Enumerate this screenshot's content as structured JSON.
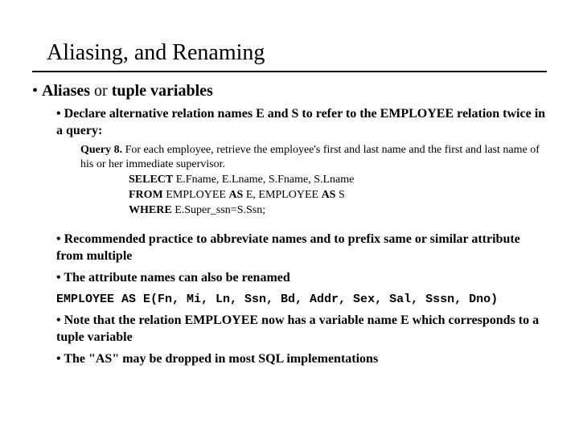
{
  "title": "Aliasing, and Renaming",
  "main_bullet": {
    "strong1": "Aliases",
    "mid": " or ",
    "strong2": "tuple variables"
  },
  "sub1": "Declare alternative relation names E and S to refer to the EMPLOYEE relation twice in a query:",
  "query_label": "Query 8.",
  "query_text": " For each employee, retrieve the employee's first and last name and the first and last name of his or her immediate supervisor.",
  "sql": {
    "select_kw": "SELECT",
    "select_rest": "   E.Fname, E.Lname, S.Fname, S.Lname",
    "from_kw": "FROM",
    "from_mid": "     EMPLOYEE ",
    "as1": "AS",
    "from_mid2": " E, EMPLOYEE ",
    "as2": "AS",
    "from_end": " S",
    "where_kw": "WHERE",
    "where_rest": " E.Super_ssn=S.Ssn;"
  },
  "b2": "Recommended practice to abbreviate names and to prefix same or similar attribute from multiple",
  "b3": "The attribute names can also be renamed",
  "rename_line": "EMPLOYEE AS E(Fn, Mi, Ln, Ssn, Bd, Addr, Sex, Sal, Sssn, Dno)",
  "b4": "Note that the relation EMPLOYEE now has a variable name E which corresponds to a tuple variable",
  "b5": "The \"AS\" may be dropped in most SQL implementations"
}
